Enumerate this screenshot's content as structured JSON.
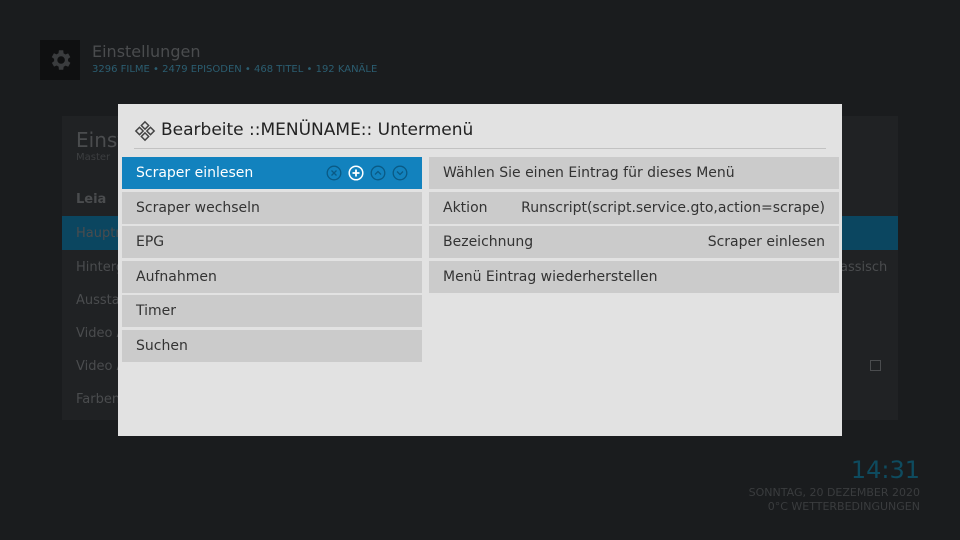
{
  "background": {
    "title": "Einstellungen",
    "stats": "3296 FILME • 2479 EPISODEN • 468 TITEL • 192 KANÄLE",
    "panel_title": "Einst",
    "panel_subtitle": "Master",
    "rows": [
      "Leia",
      "Hauptm",
      "Hinterg",
      "Ausstat",
      "Video A",
      "Video A",
      "Farben"
    ],
    "right_text": "assisch",
    "time": "14:31",
    "date": "SONNTAG, 20 DEZEMBER 2020",
    "weather": "0°C  WETTERBEDINGUNGEN"
  },
  "dialog": {
    "title": "Bearbeite ::MENÜNAME:: Untermenü",
    "menu_items": [
      {
        "label": "Scraper einlesen"
      },
      {
        "label": "Scraper wechseln"
      },
      {
        "label": "EPG"
      },
      {
        "label": "Aufnahmen"
      },
      {
        "label": "Timer"
      },
      {
        "label": "Suchen"
      }
    ],
    "options": [
      {
        "label": "Wählen Sie einen Eintrag für dieses Menü",
        "value": ""
      },
      {
        "label": "Aktion",
        "value": "Runscript(script.service.gto,action=scrape)"
      },
      {
        "label": "Bezeichnung",
        "value": "Scraper einlesen"
      },
      {
        "label": "Menü Eintrag wiederherstellen",
        "value": ""
      }
    ]
  },
  "colors": {
    "accent": "#1282be",
    "dialog_bg": "#e2e2e2",
    "item_bg": "#cbcbcb"
  },
  "icons": [
    "gear-icon",
    "kodi-logo-icon",
    "remove-icon",
    "add-icon",
    "move-up-icon",
    "move-down-icon"
  ]
}
